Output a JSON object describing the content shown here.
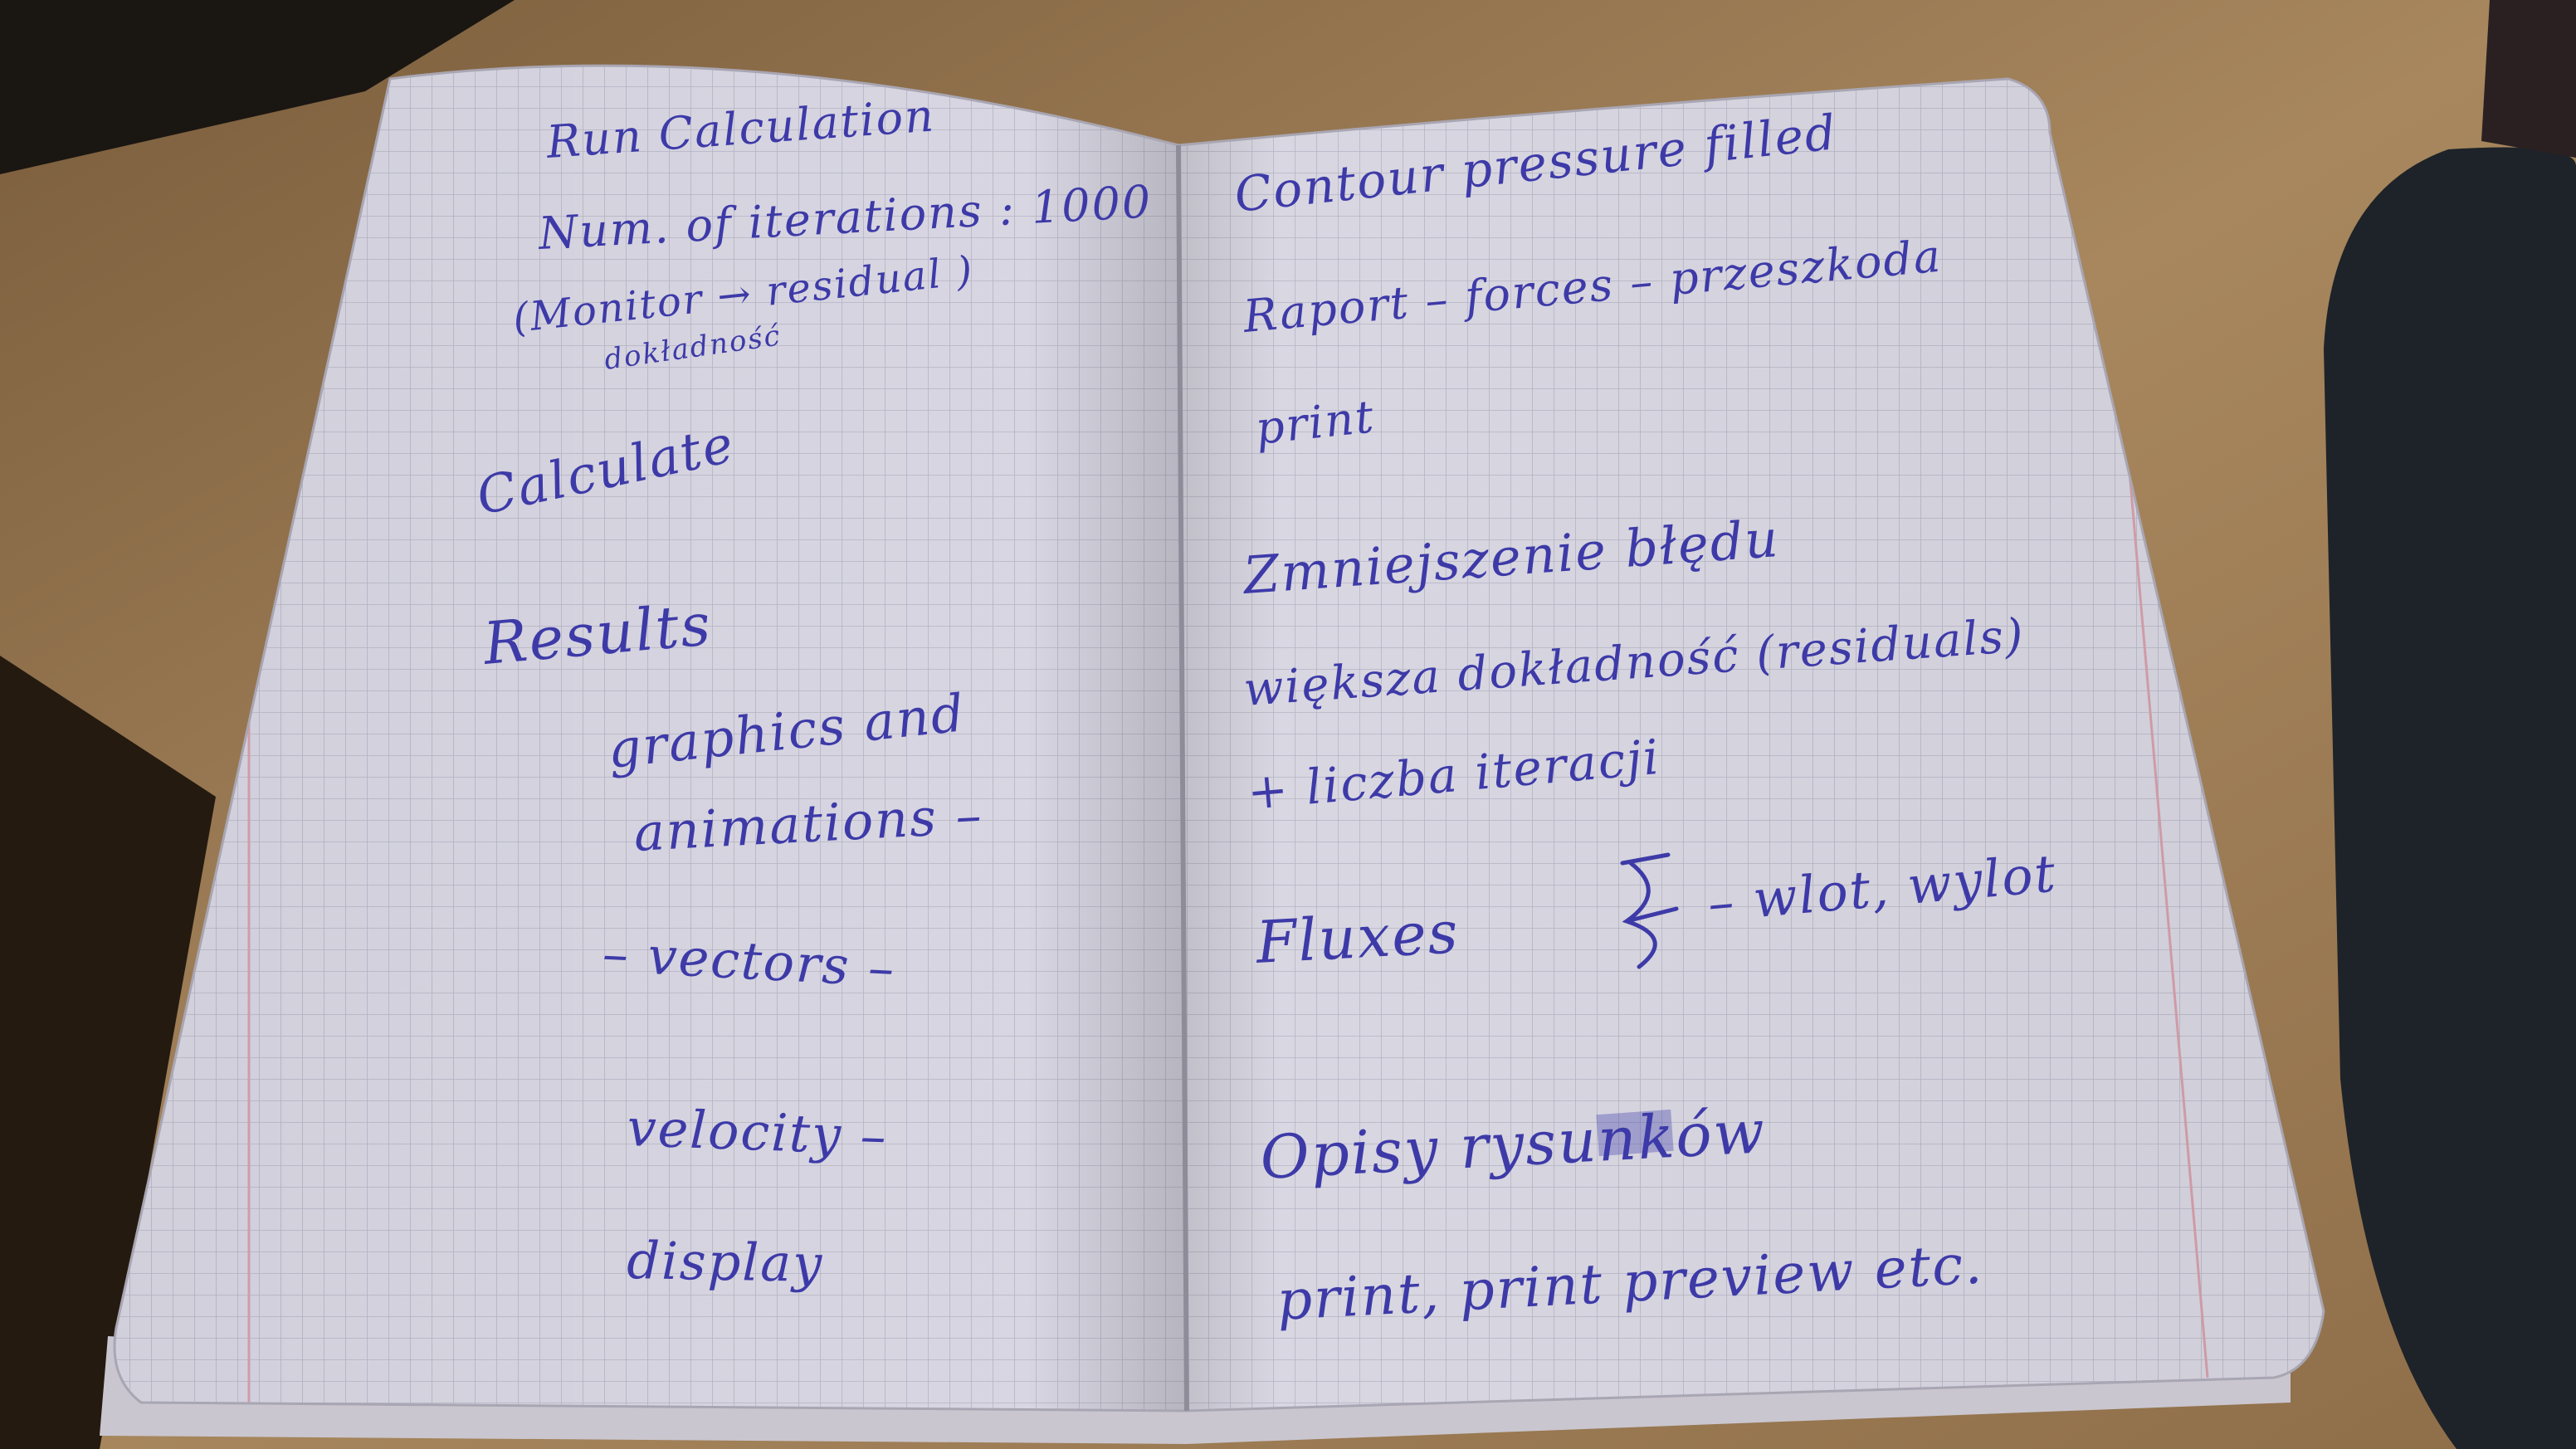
{
  "colors": {
    "ink": "#3d3aa8",
    "paper": "#dcdae6",
    "grid": "#b9b8c8",
    "margin_line": "#d9a4b0",
    "desk": "#a8875e",
    "mousepad": "#1e2329"
  },
  "left_page": {
    "lines": [
      "Run Calculation",
      "Num. of iterations : 1000",
      "(Monitor → residual )",
      "dokładność",
      "Calculate",
      "Results",
      "graphics and",
      "animations –",
      "– vectors –",
      "velocity –",
      "display"
    ]
  },
  "right_page": {
    "lines": [
      "Contour pressure filled",
      "Raport – forces – przeszkoda",
      "print",
      "Zmniejszenie błędu",
      "większa dokładność (residuals)",
      "+ liczba iteracji",
      "Fluxes",
      "– wlot, wylot",
      "Opisy rysunków",
      "print, print preview etc."
    ]
  }
}
